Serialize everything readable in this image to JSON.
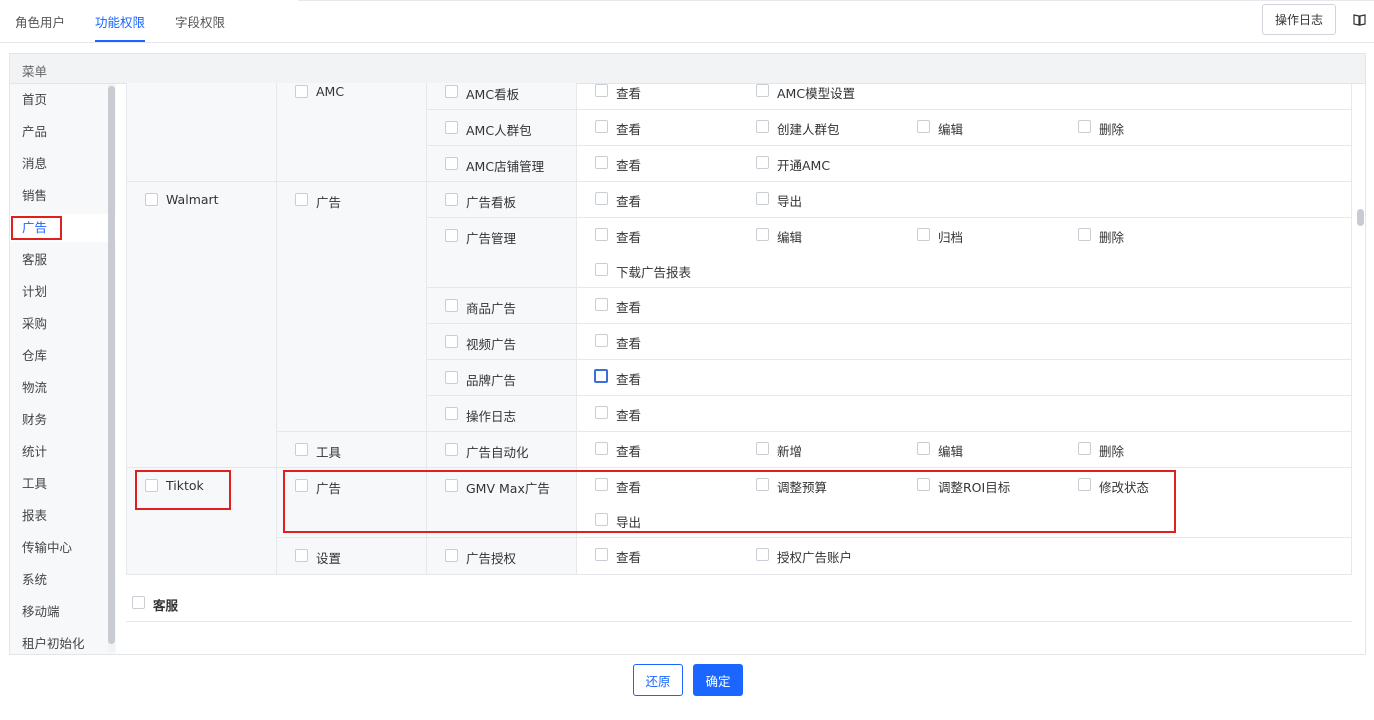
{
  "tabs": [
    "角色用户",
    "功能权限",
    "字段权限"
  ],
  "active_tab": "功能权限",
  "oplog_button": "操作日志",
  "menu_header": "菜单",
  "sidebar": [
    "首页",
    "产品",
    "消息",
    "销售",
    "广告",
    "客服",
    "计划",
    "采购",
    "仓库",
    "物流",
    "财务",
    "统计",
    "工具",
    "报表",
    "传输中心",
    "系统",
    "移动端",
    "租户初始化"
  ],
  "sidebar_active": "广告",
  "platforms": {
    "walmart": "Walmart",
    "tiktok": "Tiktok"
  },
  "modules": {
    "amc": "AMC",
    "walmart_ad": "广告",
    "walmart_tool": "工具",
    "tiktok_ad": "广告",
    "tiktok_settings": "设置"
  },
  "rows": [
    {
      "page": "AMC看板",
      "perms": [
        "查看",
        "AMC模型设置"
      ]
    },
    {
      "page": "AMC人群包",
      "perms": [
        "查看",
        "创建人群包",
        "编辑",
        "删除"
      ]
    },
    {
      "page": "AMC店铺管理",
      "perms": [
        "查看",
        "开通AMC"
      ]
    },
    {
      "page": "广告看板",
      "perms": [
        "查看",
        "导出"
      ]
    },
    {
      "page": "广告管理",
      "perms": [
        "查看",
        "编辑",
        "归档",
        "删除",
        "下载广告报表"
      ]
    },
    {
      "page": "商品广告",
      "perms": [
        "查看"
      ]
    },
    {
      "page": "视频广告",
      "perms": [
        "查看"
      ]
    },
    {
      "page": "品牌广告",
      "perms": [
        "查看"
      ]
    },
    {
      "page": "操作日志",
      "perms": [
        "查看"
      ]
    },
    {
      "page": "广告自动化",
      "perms": [
        "查看",
        "新增",
        "编辑",
        "删除"
      ]
    },
    {
      "page": "GMV Max广告",
      "perms": [
        "查看",
        "调整预算",
        "调整ROI目标",
        "修改状态",
        "导出"
      ]
    },
    {
      "page": "广告授权",
      "perms": [
        "查看",
        "授权广告账户"
      ]
    }
  ],
  "next_section": "客服",
  "buttons": {
    "restore": "还原",
    "confirm": "确定"
  },
  "colors": {
    "accent": "#1a66ff",
    "highlight": "#e0201e"
  }
}
